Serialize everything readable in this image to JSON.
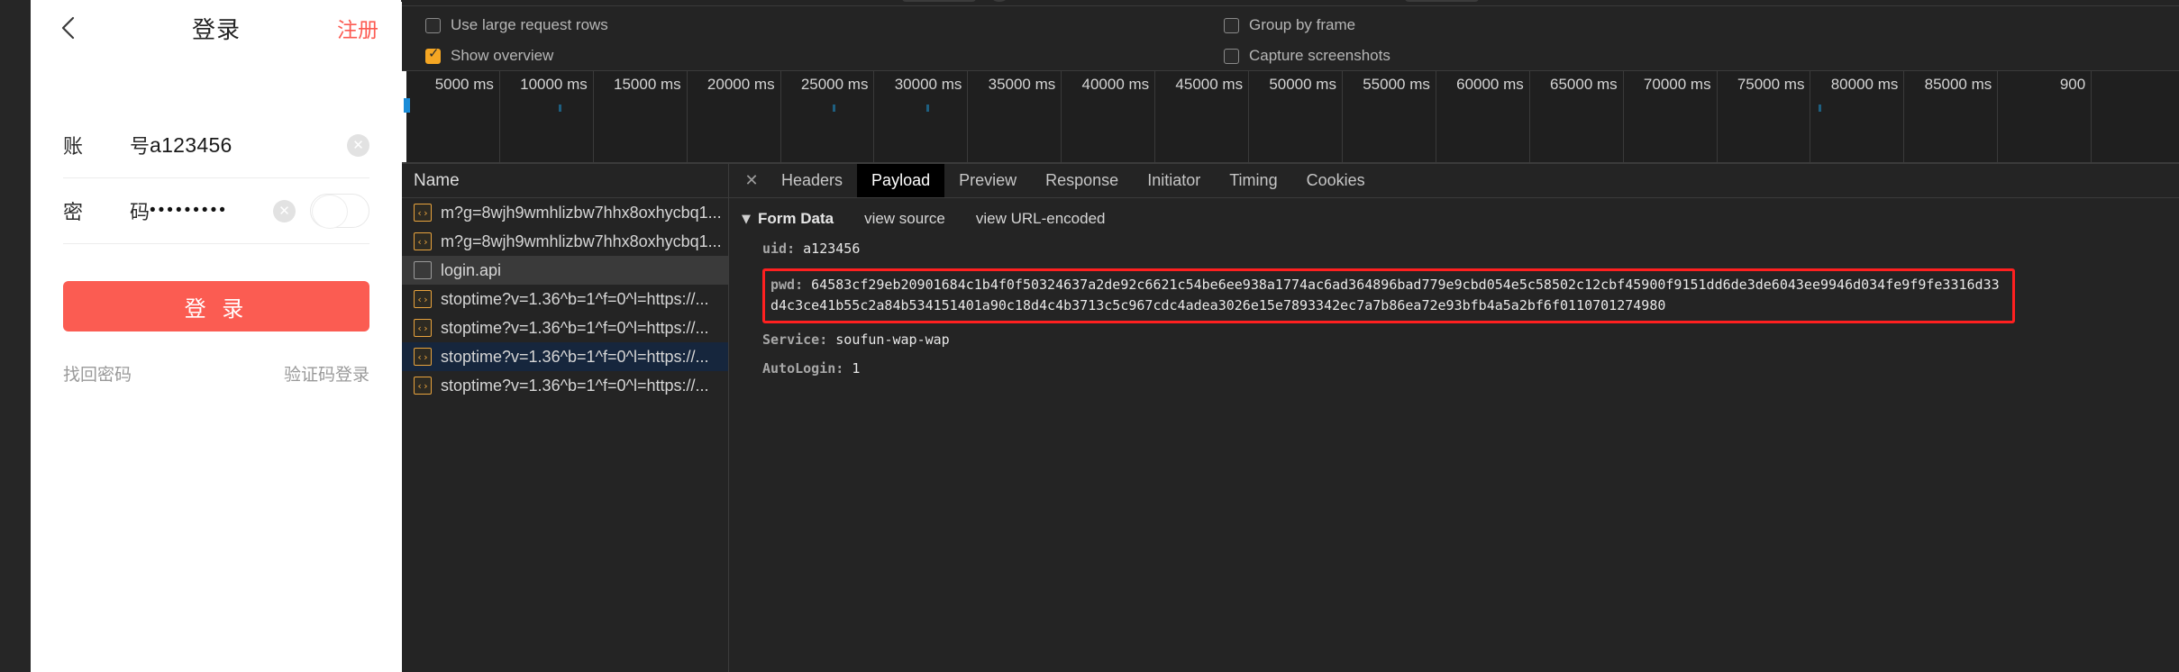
{
  "phone": {
    "back_icon": "chevron-left-icon",
    "title": "登录",
    "register_label": "注册",
    "fields": [
      {
        "label_left": "账",
        "label_right": "号",
        "value": "a123456",
        "clear_glyph": "✕"
      },
      {
        "label_left": "密",
        "label_right": "码",
        "value": "•••••••••",
        "clear_glyph": "✕"
      }
    ],
    "login_button": "登 录",
    "footer": {
      "forgot": "找回密码",
      "sms_login": "验证码登录"
    },
    "accent_color": "#fb5c52"
  },
  "devtools": {
    "settings": {
      "use_large_request_rows": {
        "label": "Use large request rows",
        "checked": false
      },
      "show_overview": {
        "label": "Show overview",
        "checked": true
      },
      "group_by_frame": {
        "label": "Group by frame",
        "checked": false
      },
      "capture_screenshots": {
        "label": "Capture screenshots",
        "checked": false
      }
    },
    "overview": {
      "ticks": [
        "5000 ms",
        "10000 ms",
        "15000 ms",
        "20000 ms",
        "25000 ms",
        "30000 ms",
        "35000 ms",
        "40000 ms",
        "45000 ms",
        "50000 ms",
        "55000 ms",
        "60000 ms",
        "65000 ms",
        "70000 ms",
        "75000 ms",
        "80000 ms",
        "85000 ms",
        "900"
      ],
      "marker_color": "#1a8cd8"
    },
    "requests": {
      "column_header": "Name",
      "rows": [
        {
          "icon": "js-file-icon",
          "name": "m?g=8wjh9wmhlizbw7hhx8oxhycbq1...",
          "state": "normal"
        },
        {
          "icon": "js-file-icon",
          "name": "m?g=8wjh9wmhlizbw7hhx8oxhycbq1...",
          "state": "normal"
        },
        {
          "icon": "document-icon",
          "name": "login.api",
          "state": "selected"
        },
        {
          "icon": "js-file-icon",
          "name": "stoptime?v=1.36^b=1^f=0^l=https://...",
          "state": "normal"
        },
        {
          "icon": "js-file-icon",
          "name": "stoptime?v=1.36^b=1^f=0^l=https://...",
          "state": "normal"
        },
        {
          "icon": "js-file-icon",
          "name": "stoptime?v=1.36^b=1^f=0^l=https://...",
          "state": "highlighted"
        },
        {
          "icon": "js-file-icon",
          "name": "stoptime?v=1.36^b=1^f=0^l=https://...",
          "state": "normal"
        }
      ]
    },
    "tabs": {
      "close_glyph": "✕",
      "items": [
        "Headers",
        "Payload",
        "Preview",
        "Response",
        "Initiator",
        "Timing",
        "Cookies"
      ],
      "active": "Payload"
    },
    "payload": {
      "section_title": "Form Data",
      "triangle": "▼",
      "view_source": "view source",
      "view_url_encoded": "view URL-encoded",
      "uid_key": "uid:",
      "uid_value": "a123456",
      "pwd_key": "pwd:",
      "pwd_value": "64583cf29eb20901684c1b4f0f50324637a2de92c6621c54be6ee938a1774ac6ad364896bad779e9cbd054e5c58502c12cbf45900f9151dd6de3de6043ee9946d034fe9f9fe3316d33d4c3ce41b55c2a84b534151401a90c18d4c4b3713c5c967cdc4adea3026e15e7893342ec7a7b86ea72e93bfb4a5a2bf6f0110701274980",
      "service_key": "Service:",
      "service_value": "soufun-wap-wap",
      "autologin_key": "AutoLogin:",
      "autologin_value": "1",
      "highlight_color": "#ff2020"
    }
  }
}
